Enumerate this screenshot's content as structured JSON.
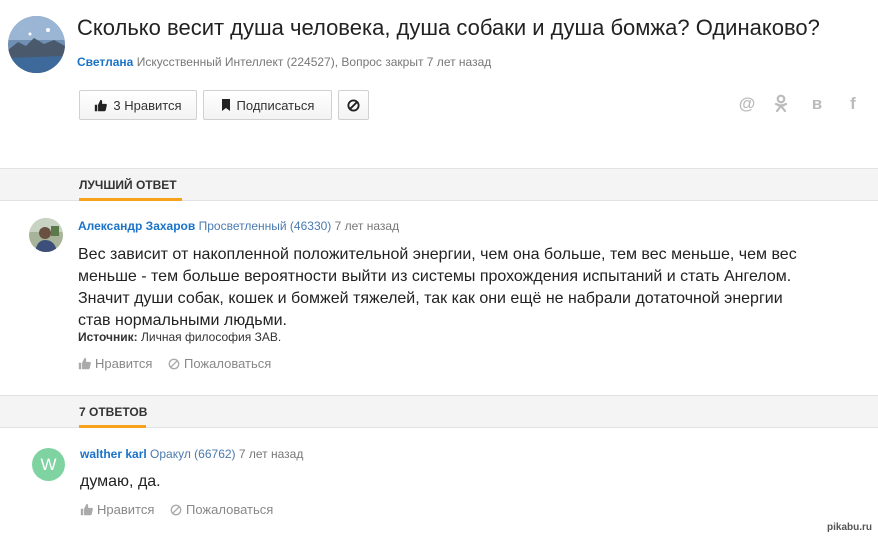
{
  "question": {
    "title": "Сколько весит душа человека, душа собаки и душа бомжа? Одинаково?",
    "author": "Светлана",
    "author_rank": "Искусственный Интеллект (224527),",
    "status": "Вопрос закрыт 7 лет назад",
    "like_label": "3 Нравится",
    "subscribe_label": "Подписаться"
  },
  "share": {
    "at": "@",
    "ok": "ꝏ",
    "vk": "в",
    "fb": "f"
  },
  "best_answer": {
    "section_label": "ЛУЧШИЙ ОТВЕТ",
    "author": "Александр Захаров",
    "author_rank": "Просветленный (46330)",
    "time": "7 лет назад",
    "text": "Вес зависит от накопленной положительной энергии, чем она больше, тем вес меньше, чем вес меньше - тем больше вероятности выйти из системы прохождения испытаний и стать Ангелом. Значит души собак, кошек и бомжей тяжелей, так как они ещё не набрали дотаточной энергии став нормальными людьми.",
    "source_label": "Источник:",
    "source_value": "Личная философия ЗАВ.",
    "like_label": "Нравится",
    "report_label": "Пожаловаться"
  },
  "answers": {
    "section_label": "7 ОТВЕТОВ",
    "items": [
      {
        "avatar_letter": "W",
        "author": "walther karl",
        "author_rank": "Оракул (66762)",
        "time": "7 лет назад",
        "text": "думаю, да.",
        "like_label": "Нравится",
        "report_label": "Пожаловаться"
      }
    ]
  },
  "watermark": "pikabu.ru",
  "colors": {
    "link": "#1a73c9",
    "accent": "#f7a21b",
    "avatar_w": "#7ed3a1"
  }
}
